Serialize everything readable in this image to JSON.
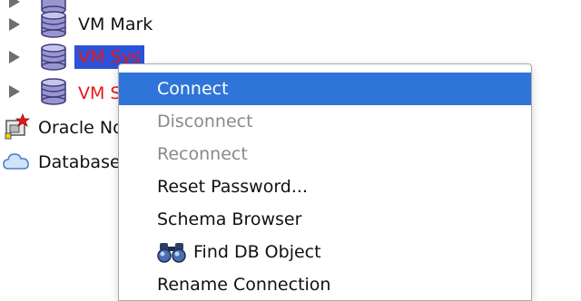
{
  "tree": {
    "nodes": [
      {
        "label": "",
        "icon": "database-icon",
        "expandable": true
      },
      {
        "label": "VM Mark",
        "icon": "database-icon",
        "expandable": true,
        "color": "#111111"
      },
      {
        "label": "VM Sys",
        "icon": "database-icon",
        "expandable": true,
        "color": "#e8161b",
        "selected": true
      },
      {
        "label": "VM S",
        "icon": "database-icon",
        "expandable": true,
        "color": "#e8161b"
      },
      {
        "label": "Oracle No",
        "icon": "oracle-network-icon"
      },
      {
        "label": "Database",
        "icon": "cloud-icon"
      }
    ]
  },
  "context_menu": {
    "items": [
      {
        "label": "Connect",
        "state": "active"
      },
      {
        "label": "Disconnect",
        "state": "disabled"
      },
      {
        "label": "Reconnect",
        "state": "disabled"
      },
      {
        "label": "Reset Password...",
        "state": "enabled"
      },
      {
        "label": "Schema Browser",
        "state": "enabled"
      },
      {
        "label": "Find DB Object",
        "state": "enabled",
        "icon": "binoculars-icon"
      },
      {
        "label": "Rename Connection",
        "state": "enabled"
      }
    ]
  },
  "colors": {
    "selection_blue": "#2c52d6",
    "menu_highlight": "#2f74d9",
    "error_red": "#e8161b",
    "disabled_gray": "#8a8a8a"
  }
}
